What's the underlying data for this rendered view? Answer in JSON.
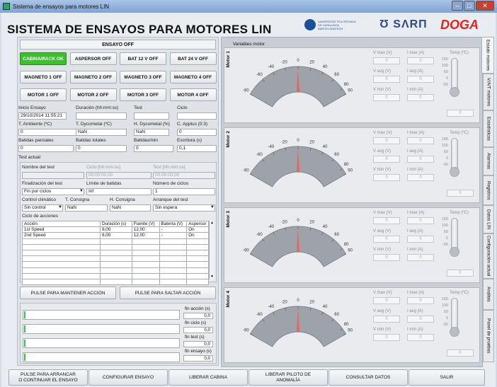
{
  "window": {
    "title": "Sistema de ensayos para motores LIN",
    "min": "‒",
    "max": "□",
    "close": "✕"
  },
  "app_title": "SISTEMA DE ENSAYOS PARA MOTORES LIN",
  "logos": {
    "upv_text_1": "UNIVERSITAT POLITÈCNICA",
    "upv_text_2": "DE CATALUNYA",
    "upv_text_3": "BARCELONATECH",
    "saar": "Ʊ SΛRП",
    "doga": "DOGA"
  },
  "ensayo_status": "ENSAYO OFF",
  "buttons_row1": [
    "CABINA/RACK OK",
    "ASPERSOR OFF",
    "BAT 12 V OFF",
    "BAT 24 V OFF"
  ],
  "buttons_row2": [
    "MAGNETO 1 OFF",
    "MAGNETO 2 OFF",
    "MAGNETO 3 OFF",
    "MAGNETO 4 OFF"
  ],
  "buttons_row3": [
    "MOTOR 1 OFF",
    "MOTOR 2 OFF",
    "MOTOR 3 OFF",
    "MOTOR 4 OFF"
  ],
  "info": {
    "inicio_label": "Inicio Ensayo",
    "inicio": "29/10/2014 11:55:21",
    "duracion_label": "Duración (hh:mm:ss)",
    "duracion": "",
    "test_label": "Test",
    "test": "",
    "ciclo_label": "Ciclo",
    "ciclo": "",
    "tamb_label": "T. Ambiente (ºC)",
    "tamb": "0",
    "tdyco_label": "T. Dycometal (ºC)",
    "tdyco": "NaN",
    "hdyco_label": "H. Dycometal (%)",
    "hdyco": "NaN",
    "capplus_label": "C. Applus (0:3)",
    "capplus": "0",
    "batparc_label": "Batidas parciales",
    "batparc": "0",
    "battot_label": "Batidas totales",
    "battot": "0",
    "batmin_label": "Batidas/min",
    "batmin": "0",
    "escritura_label": "Escritura (s)",
    "escritura": "0,1"
  },
  "test_actual": {
    "label": "Test actual",
    "nombre_label": "Nombre del test",
    "nombre": "",
    "ciclo_label": "Ciclo [hh:mm:ss]",
    "ciclo": "00:00:00,00",
    "test_label": "Test [hh:mm:ss]",
    "test": "00:00:00,00",
    "fin_label": "Finalización del test",
    "fin": "Fin por ciclos",
    "limite_label": "Límite de batidas",
    "limite": "Inf",
    "numciclos_label": "Número de ciclos",
    "numciclos": "1",
    "control_label": "Control climático",
    "control": "Sin control",
    "tcons_label": "T. Consigna",
    "tcons": "NaN",
    "hcons_label": "H. Consigna",
    "hcons": "NaN",
    "arranque_label": "Arranque del test",
    "arranque": "Sin espera",
    "ciclo_acciones_label": "Ciclo de acciones"
  },
  "acciones": {
    "headers": [
      "Acción",
      "Duración (s)",
      "Fuente (V)",
      "Batería (V)",
      "Aspersor"
    ],
    "rows": [
      [
        "1st Speed",
        "9,00",
        "12,00",
        "-",
        "On"
      ],
      [
        "2nd Speed",
        "8,00",
        "12,00",
        "-",
        "On"
      ],
      [
        "",
        "",
        "",
        "",
        ""
      ],
      [
        "",
        "",
        "",
        "",
        ""
      ],
      [
        "",
        "",
        "",
        "",
        ""
      ],
      [
        "",
        "",
        "",
        "",
        ""
      ],
      [
        "",
        "",
        "",
        "",
        ""
      ],
      [
        "",
        "",
        "",
        "",
        ""
      ],
      [
        "",
        "",
        "",
        "",
        ""
      ],
      [
        "",
        "",
        "",
        "",
        ""
      ]
    ]
  },
  "pulse_mantener": "PULSE PARA MANTENER ACCIÓN",
  "pulse_saltar": "PULSE PARA SALTAR ACCIÓN",
  "progress": [
    {
      "label": "fin acción (s)",
      "value": "0,0",
      "fraction": 0.01
    },
    {
      "label": "fin ciclo (s)",
      "value": "0,0",
      "fraction": 0.01
    },
    {
      "label": "fin test (s)",
      "value": "0,0",
      "fraction": 0.01
    },
    {
      "label": "fin ensayo (s)",
      "value": "0,0",
      "fraction": 0.01
    }
  ],
  "variables_title": "Variables motor",
  "motors": [
    {
      "label": "Motor 1",
      "vmax_label": "V max (V)",
      "vmax": "0",
      "imax_label": "I max (A)",
      "imax": "0",
      "vavg_label": "V avg (V)",
      "vavg": "0",
      "iavg_label": "I avg (A)",
      "iavg": "0",
      "vmin_label": "V min (V)",
      "vmin": "0",
      "imin_label": "I min (A)",
      "imin": "0",
      "temp_label": "Temp (ºC)",
      "temp": "0",
      "gauge_value": 0
    },
    {
      "label": "Motor 2",
      "vmax_label": "V max (V)",
      "vmax": "0",
      "imax_label": "I max (A)",
      "imax": "0",
      "vavg_label": "V avg (V)",
      "vavg": "0",
      "iavg_label": "I avg (A)",
      "iavg": "0",
      "vmin_label": "V min (V)",
      "vmin": "0",
      "imin_label": "I min (A)",
      "imin": "0",
      "temp_label": "Temp (ºC)",
      "temp": "0",
      "gauge_value": 0
    },
    {
      "label": "Motor 3",
      "vmax_label": "V max (V)",
      "vmax": "0",
      "imax_label": "I max (A)",
      "imax": "0",
      "vavg_label": "V avg (V)",
      "vavg": "0",
      "iavg_label": "I avg (A)",
      "iavg": "0",
      "vmin_label": "V min (V)",
      "vmin": "0",
      "imin_label": "I min (A)",
      "imin": "0",
      "temp_label": "Temp (ºC)",
      "temp": "0",
      "gauge_value": 0
    },
    {
      "label": "Motor 4",
      "vmax_label": "V max (V)",
      "vmax": "0",
      "imax_label": "I max (A)",
      "imax": "0",
      "vavg_label": "V avg (V)",
      "vavg": "0",
      "iavg_label": "I avg (A)",
      "iavg": "0",
      "vmin_label": "V min (V)",
      "vmin": "0",
      "imin_label": "I min (A)",
      "imin": "0",
      "temp_label": "Temp (ºC)",
      "temp": "0",
      "gauge_value": 0
    }
  ],
  "gauge_ticks": [
    "-90",
    "-60",
    "-40",
    "-20",
    "0",
    "20",
    "40",
    "60",
    "80",
    "90"
  ],
  "temp_ticks": [
    "150",
    "100",
    "50",
    "0",
    "-50"
  ],
  "tabs": [
    "Estado motores",
    "V/A/T motores",
    "Estadísticas",
    "Alarmas",
    "Registros",
    "Datos LIN",
    "Configuración actual",
    "Análisis",
    "Panel de pruebas"
  ],
  "bottom_buttons": [
    "PULSE PARA ARRANCAR\nO CONTINUAR EL ENSAYO",
    "CONFIGURAR ENSAYO",
    "LIBERAR CABINA",
    "LIBERAR PILOTO DE\nANOMALÍA",
    "CONSULTAR DATOS",
    "SALIR"
  ],
  "colors": {
    "green": "#3fbf2f",
    "needle": "#e0686a",
    "progress": "#3ac23a"
  }
}
